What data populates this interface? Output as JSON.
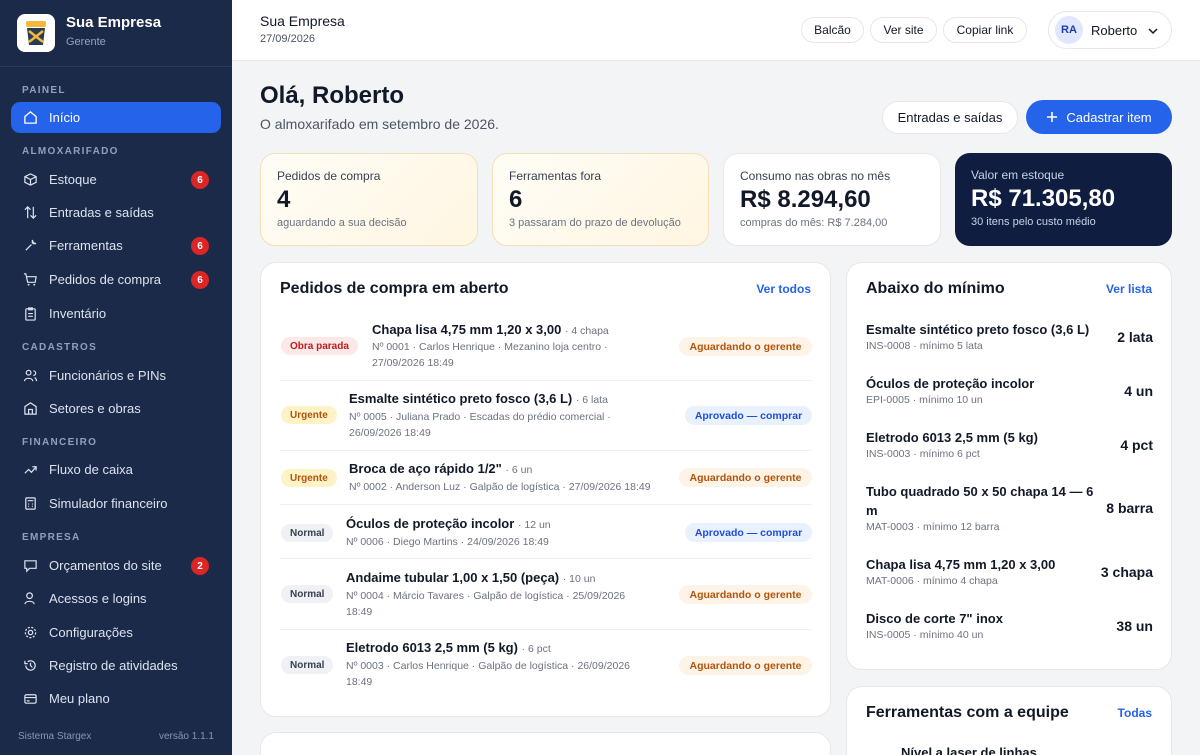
{
  "company": {
    "name": "Sua Empresa",
    "role": "Gerente"
  },
  "sidebar": {
    "sections": [
      "PAINEL",
      "ALMOXARIFADO",
      "CADASTROS",
      "FINANCEIRO",
      "EMPRESA"
    ],
    "items": [
      {
        "label": "Início",
        "icon": "home-icon"
      },
      {
        "label": "Estoque",
        "icon": "box-icon",
        "badge": "6"
      },
      {
        "label": "Entradas e saídas",
        "icon": "arrows-icon"
      },
      {
        "label": "Ferramentas",
        "icon": "wrench-icon",
        "badge": "6"
      },
      {
        "label": "Pedidos de compra",
        "icon": "cart-icon",
        "badge": "6"
      },
      {
        "label": "Inventário",
        "icon": "clipboard-icon"
      },
      {
        "label": "Funcionários e PINs",
        "icon": "users-icon"
      },
      {
        "label": "Setores e obras",
        "icon": "building-icon"
      },
      {
        "label": "Fluxo de caixa",
        "icon": "cash-icon"
      },
      {
        "label": "Simulador financeiro",
        "icon": "calculator-icon"
      },
      {
        "label": "Orçamentos do site",
        "icon": "quote-icon",
        "badge": "2"
      },
      {
        "label": "Acessos e logins",
        "icon": "user-key-icon"
      },
      {
        "label": "Configurações",
        "icon": "gear-icon"
      },
      {
        "label": "Registro de atividades",
        "icon": "history-icon"
      },
      {
        "label": "Meu plano",
        "icon": "card-icon"
      }
    ],
    "footer_left": "Sistema Stargex",
    "footer_right": "versão 1.1.1"
  },
  "topbar": {
    "title": "Sua Empresa",
    "date": "27/09/2026",
    "buttons": [
      "Balcão",
      "Ver site",
      "Copiar link"
    ],
    "user_initials": "RA",
    "user_name": "Roberto"
  },
  "greeting": {
    "title": "Olá, Roberto",
    "subtitle": "O almoxarifado em setembro de 2026."
  },
  "actions": {
    "secondary": "Entradas e saídas",
    "primary": "Cadastrar item"
  },
  "stats": [
    {
      "label": "Pedidos de compra",
      "value": "4",
      "sub": "aguardando a sua decisão"
    },
    {
      "label": "Ferramentas fora",
      "value": "6",
      "sub": "3 passaram do prazo de devolução"
    },
    {
      "label": "Consumo nas obras no mês",
      "value": "R$ 8.294,60",
      "sub": "compras do mês: R$ 7.284,00"
    },
    {
      "label": "Valor em estoque",
      "value": "R$ 71.305,80",
      "sub": "30 itens pelo custo médio"
    }
  ],
  "orders": {
    "title": "Pedidos de compra em aberto",
    "link": "Ver todos",
    "rows": [
      {
        "tag": "Obra parada",
        "name": "Chapa lisa 4,75 mm 1,20 x 3,00",
        "qty": "· 4 chapa",
        "meta1": "Nº 0001 · Carlos Henrique · Mezanino loja centro ·",
        "meta2": "27/09/2026 18:49",
        "status": "Aguardando o gerente"
      },
      {
        "tag": "Urgente",
        "name": "Esmalte sintético preto fosco (3,6 L)",
        "qty": "· 6 lata",
        "meta1": "Nº 0005 · Juliana Prado · Escadas do prédio comercial ·",
        "meta2": "26/09/2026 18:49",
        "status": "Aprovado — comprar"
      },
      {
        "tag": "Urgente",
        "name": "Broca de aço rápido 1/2\"",
        "qty": "· 6 un",
        "meta1": "Nº 0002 · Anderson Luz · Galpão de logística · 27/09/2026 18:49",
        "meta2": "",
        "status": "Aguardando o gerente"
      },
      {
        "tag": "Normal",
        "name": "Óculos de proteção incolor",
        "qty": "· 12 un",
        "meta1": "Nº 0006 · Diego Martins · 24/09/2026 18:49",
        "meta2": "",
        "status": "Aprovado — comprar"
      },
      {
        "tag": "Normal",
        "name": "Andaime tubular 1,00 x 1,50 (peça)",
        "qty": "· 10 un",
        "meta1": "Nº 0004 · Márcio Tavares · Galpão de logística · 25/09/2026",
        "meta2": "18:49",
        "status": "Aguardando o gerente"
      },
      {
        "tag": "Normal",
        "name": "Eletrodo 6013 2,5 mm (5 kg)",
        "qty": "· 6 pct",
        "meta1": "Nº 0003 · Carlos Henrique · Galpão de logística · 26/09/2026",
        "meta2": "18:49",
        "status": "Aguardando o gerente"
      }
    ]
  },
  "below_min": {
    "title": "Abaixo do mínimo",
    "link": "Ver lista",
    "rows": [
      {
        "name": "Esmalte sintético preto fosco (3,6 L)",
        "meta": "INS-0008 · mínimo 5 lata",
        "qty": "2 lata"
      },
      {
        "name": "Óculos de proteção incolor",
        "meta": "EPI-0005 · mínimo 10 un",
        "qty": "4 un"
      },
      {
        "name": "Eletrodo 6013 2,5 mm (5 kg)",
        "meta": "INS-0003 · mínimo 6 pct",
        "qty": "4 pct"
      },
      {
        "name": "Tubo quadrado 50 x 50 chapa 14 — 6 m",
        "meta": "MAT-0003 · mínimo 12 barra",
        "qty": "8 barra"
      },
      {
        "name": "Chapa lisa 4,75 mm 1,20 x 3,00",
        "meta": "MAT-0006 · mínimo 4 chapa",
        "qty": "3 chapa"
      },
      {
        "name": "Disco de corte 7\" inox",
        "meta": "INS-0005 · mínimo 40 un",
        "qty": "38 un"
      }
    ]
  },
  "tools_card": {
    "title": "Ferramentas com a equipe",
    "link": "Todas",
    "first_item": "Nível a laser de linhas"
  },
  "colors": {
    "sidebar": "#1b2a48",
    "accent": "#2563eb",
    "dark_card": "#0f1e40",
    "badge": "#dc2626"
  }
}
